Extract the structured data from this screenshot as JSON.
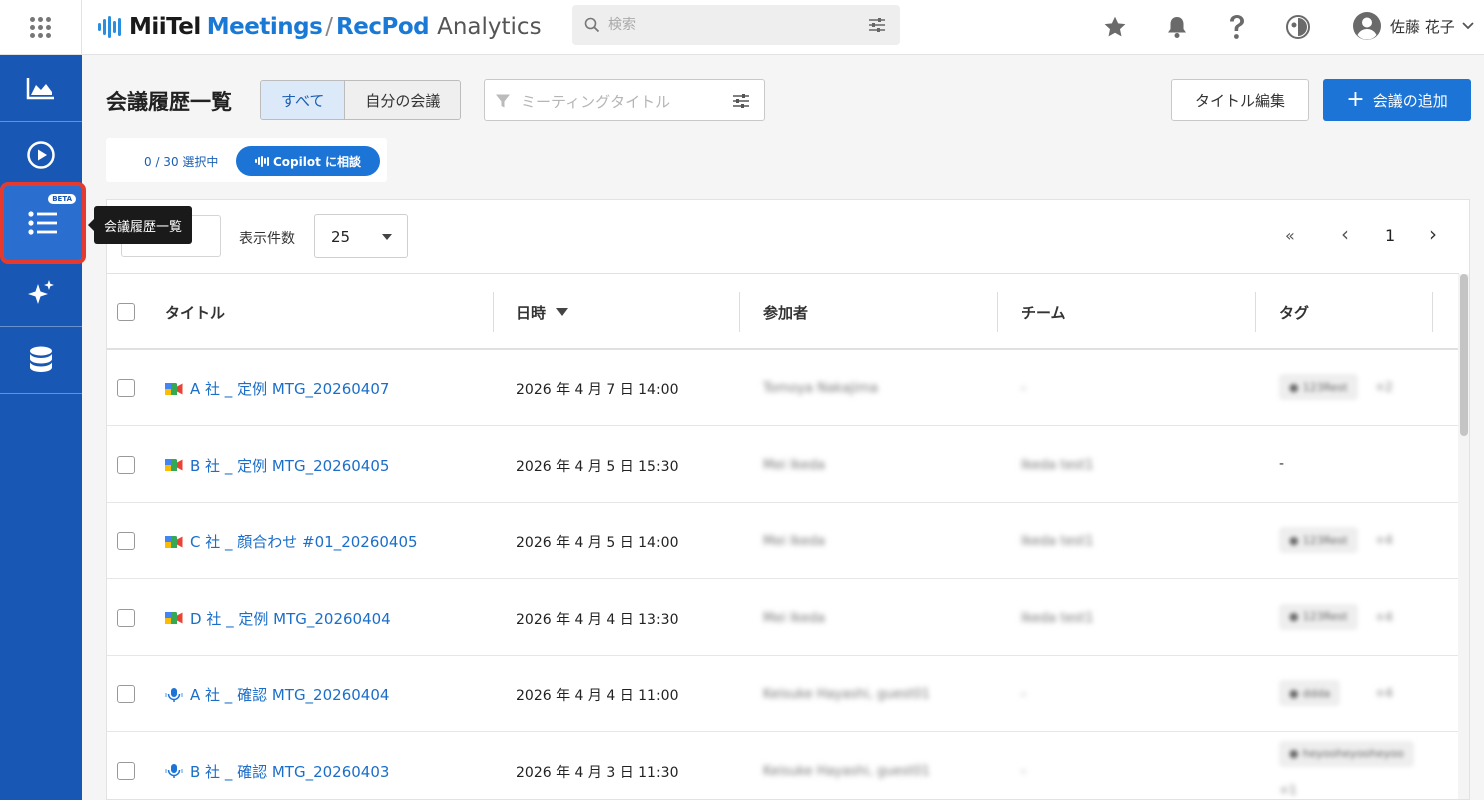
{
  "header": {
    "logo": {
      "part1": "MiiTel",
      "part2": "Meetings",
      "sep": "/",
      "part3": "RecPod",
      "part4": "Analytics"
    },
    "search_placeholder": "検索",
    "user_name": "佐藤 花子"
  },
  "sidebar": {
    "beta_badge": "BETA",
    "tooltip": "会議履歴一覧"
  },
  "page": {
    "title": "会議履歴一覧",
    "tabs": [
      "すべて",
      "自分の会議"
    ],
    "filter_placeholder": "ミーティングタイトル",
    "title_edit_label": "タイトル編集",
    "add_label": "会議の追加",
    "selection": "0 / 30 選択中",
    "copilot_label": "Copilot に相談"
  },
  "table": {
    "per_page_label": "表示件数",
    "per_page_value": "25",
    "pager": {
      "first": "«",
      "prev": "‹",
      "page": "1",
      "next": "›"
    },
    "columns": [
      "タイトル",
      "日時",
      "参加者",
      "チーム",
      "タグ"
    ],
    "rows": [
      {
        "icon": "meet",
        "title": "A 社 _ 定例 MTG_20260407",
        "date": "2026 年 4 月 7 日 14:00",
        "participants": "Tomoya Nakajima",
        "team": "-",
        "tag": "123Rest",
        "tag_more": "+2"
      },
      {
        "icon": "meet",
        "title": "B 社 _ 定例 MTG_20260405",
        "date": "2026 年 4 月 5 日 15:30",
        "participants": "Mei Ikeda",
        "team": "Ikeda test1",
        "tag": "",
        "tag_more": "",
        "tag_dash": "-"
      },
      {
        "icon": "meet",
        "title": "C 社 _ 顔合わせ #01_20260405",
        "date": "2026 年 4 月 5 日 14:00",
        "participants": "Mei Ikeda",
        "team": "Ikeda test1",
        "tag": "123Rest",
        "tag_more": "+4"
      },
      {
        "icon": "meet",
        "title": "D 社 _ 定例 MTG_20260404",
        "date": "2026 年 4 月 4 日 13:30",
        "participants": "Mei Ikeda",
        "team": "Ikeda test1",
        "tag": "123Rest",
        "tag_more": "+4"
      },
      {
        "icon": "mic",
        "title": "A 社 _ 確認 MTG_20260404",
        "date": "2026 年 4 月 4 日 11:00",
        "participants": "Keisuke Hayashi, guest01",
        "team": "-",
        "tag": "ddda",
        "tag_more": "+4"
      },
      {
        "icon": "mic",
        "title": "B 社 _ 確認 MTG_20260403",
        "date": "2026 年 4 月 3 日 11:30",
        "participants": "Keisuke Hayashi, guest01",
        "team": "-",
        "tag": "heyooheyooheyoo",
        "tag_more": "+1"
      }
    ]
  }
}
